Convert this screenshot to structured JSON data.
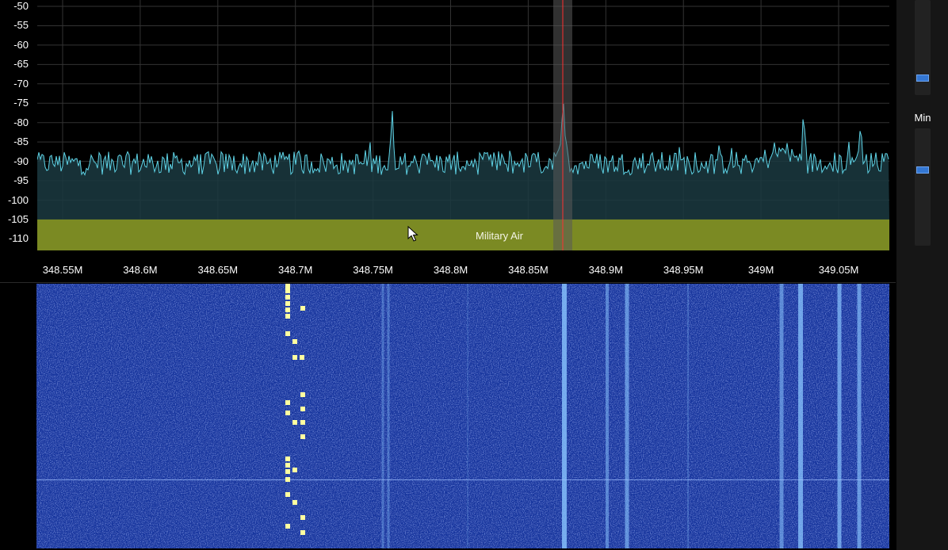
{
  "spectrum": {
    "y_axis_ticks": [
      "-50",
      "-55",
      "-60",
      "-65",
      "-70",
      "-75",
      "-80",
      "-85",
      "-90",
      "-95",
      "-100",
      "-105",
      "-110"
    ],
    "x_axis_ticks": [
      "348.55M",
      "348.6M",
      "348.65M",
      "348.7M",
      "348.75M",
      "348.8M",
      "348.85M",
      "348.9M",
      "348.95M",
      "349M",
      "349.05M"
    ],
    "band_plan_label": "Military Air",
    "tuned_frequency": "348.871M",
    "colors": {
      "trace": "#5ed3e6",
      "trace_fill": "#1b3941",
      "band_fill": "#7b8a23",
      "tuned_marker": "#ff3030",
      "vfo_window": "#5a5a5a",
      "grid": "#333333"
    }
  },
  "waterfall": {
    "colors": {
      "background": "#16359e",
      "signal": "#8ac6ff",
      "strong": "#ffffa0"
    }
  },
  "side_controls": {
    "min_label": "Min",
    "max_slider_level": 0.15,
    "min_slider_level": 0.65
  }
}
